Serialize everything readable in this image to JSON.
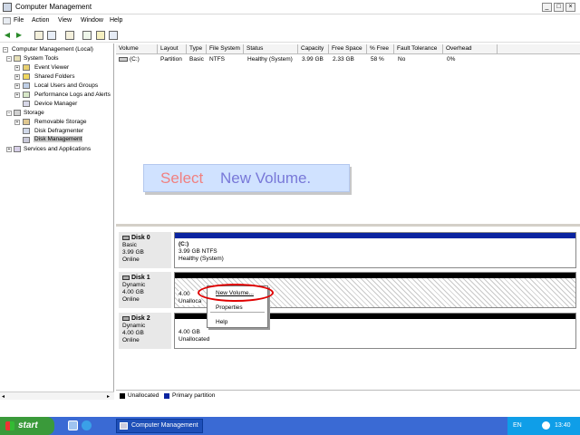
{
  "window": {
    "title": "Computer Management",
    "btn_min": "_",
    "btn_max": "□",
    "btn_close": "×"
  },
  "menu": {
    "items": [
      "File",
      "Action",
      "View",
      "Window",
      "Help"
    ]
  },
  "toolbar": {
    "icons": [
      "back-arrow-icon",
      "forward-arrow-icon",
      "up-folder-icon",
      "show-hide-tree-icon",
      "properties-icon",
      "export-list-icon",
      "help-icon",
      "new-window-icon"
    ]
  },
  "tree": {
    "items": [
      {
        "label": "Computer Management (Local)",
        "level": 0,
        "expand": "−"
      },
      {
        "label": "System Tools",
        "level": 1,
        "expand": "−"
      },
      {
        "label": "Event Viewer",
        "level": 2,
        "expand": "+"
      },
      {
        "label": "Shared Folders",
        "level": 2,
        "expand": "+"
      },
      {
        "label": "Local Users and Groups",
        "level": 2,
        "expand": "+"
      },
      {
        "label": "Performance Logs and Alerts",
        "level": 2,
        "expand": "+"
      },
      {
        "label": "Device Manager",
        "level": 2,
        "expand": ""
      },
      {
        "label": "Storage",
        "level": 1,
        "expand": "−"
      },
      {
        "label": "Removable Storage",
        "level": 2,
        "expand": "+"
      },
      {
        "label": "Disk Defragmenter",
        "level": 2,
        "expand": ""
      },
      {
        "label": "Disk Management",
        "level": 2,
        "expand": "",
        "selected": true
      },
      {
        "label": "Services and Applications",
        "level": 1,
        "expand": "+"
      }
    ]
  },
  "volume_list": {
    "columns": [
      "Volume",
      "Layout",
      "Type",
      "File System",
      "Status",
      "Capacity",
      "Free Space",
      "% Free",
      "Fault Tolerance",
      "Overhead"
    ],
    "rows": [
      [
        "(C:)",
        "Partition",
        "Basic",
        "NTFS",
        "Healthy (System)",
        "3.99 GB",
        "2.33 GB",
        "58 %",
        "No",
        "0%"
      ]
    ]
  },
  "disks": [
    {
      "name": "Disk 0",
      "type": "Basic",
      "size": "3.99 GB",
      "status": "Online",
      "vol_title": "(C:)",
      "vol_line1": "3.99 GB NTFS",
      "vol_line2": "Healthy (System)"
    },
    {
      "name": "Disk 1",
      "type": "Dynamic",
      "size": "4.00 GB",
      "status": "Online",
      "vol_line1": "4.00",
      "vol_line2": "Unalloca"
    },
    {
      "name": "Disk 2",
      "type": "Dynamic",
      "size": "4.00 GB",
      "status": "Online",
      "vol_line1": "4.00 GB",
      "vol_line2": "Unallocated"
    }
  ],
  "context_menu": {
    "items": [
      "New Volume...",
      "Properties",
      "Help"
    ]
  },
  "banner": {
    "part1": "Select ",
    "part2": "New Volume."
  },
  "legend": {
    "items": [
      "Unallocated",
      "Primary partition"
    ]
  },
  "taskbar": {
    "start": "start",
    "task": "Computer Management",
    "lang": "EN",
    "clock": "13:40"
  },
  "colors": {
    "primary_partition": "#0a24a0",
    "unallocated": "#000000",
    "highlight_ring": "#e00000"
  }
}
